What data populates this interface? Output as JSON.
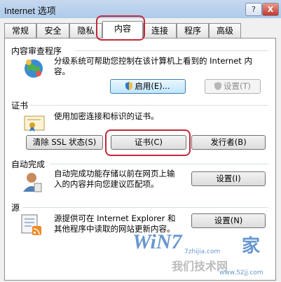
{
  "window": {
    "title": "Internet 选项",
    "help_label": "?",
    "close_label": "X"
  },
  "tabs": [
    {
      "label": "常规",
      "active": false
    },
    {
      "label": "安全",
      "active": false
    },
    {
      "label": "隐私",
      "active": false
    },
    {
      "label": "内容",
      "active": true
    },
    {
      "label": "连接",
      "active": false
    },
    {
      "label": "程序",
      "active": false
    },
    {
      "label": "高级",
      "active": false
    }
  ],
  "content_advisor": {
    "title": "内容审查程序",
    "desc_line1": "分级系统可帮助您控制在该计算机上看到的 Internet 内",
    "desc_line2": "容。",
    "enable_button": "启用(E)...",
    "settings_button": "设置(T)"
  },
  "certificates": {
    "title": "证书",
    "desc": "使用加密连接和标识的证书。",
    "clear_ssl_button": "清除 SSL 状态(S)",
    "certificates_button": "证书(C)",
    "publishers_button": "发行者(B)"
  },
  "autocomplete": {
    "title": "自动完成",
    "desc_line1": "自动完成功能存储以前在网页上输",
    "desc_line2": "入的内容并向您建议匹配项。",
    "settings_button": "设置(I)"
  },
  "feeds": {
    "title": "源",
    "desc_line1": "源提供可在 Internet Explorer 和",
    "desc_line2": "其他程序中读取的网站更新内容。",
    "settings_button": "设置(N)"
  },
  "watermark": {
    "brand": "WiN7",
    "site": "7zhijia.com",
    "url": "www.52jj.com",
    "tagline": "我们技术网",
    "home": "家"
  },
  "colors": {
    "highlight": "#c0283a",
    "accent": "#3c7fb1"
  }
}
